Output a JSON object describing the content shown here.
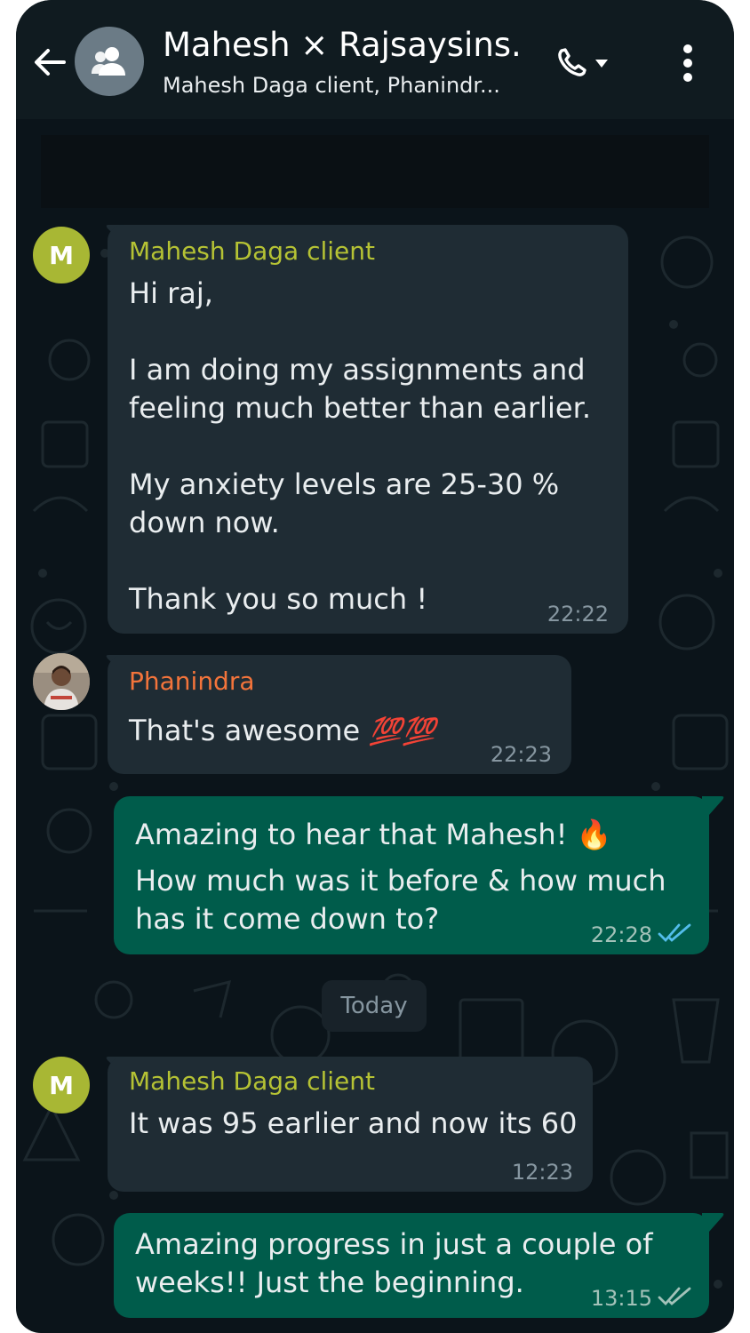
{
  "header": {
    "title": "Mahesh × Rajsaysins...",
    "subtitle": "Mahesh Daga client, Phanindr...",
    "back_icon": "arrow-left-icon",
    "avatar_icon": "group-icon",
    "call_icon": "phone-icon",
    "menu_icon": "more-vertical-icon"
  },
  "colors": {
    "background": "#0b141a",
    "incoming_bubble": "#1f2c34",
    "outgoing_bubble": "#005c4b",
    "mahesh_name": "#b5c234",
    "phanindra_name": "#f3743b",
    "read_ticks": "#53bdeb"
  },
  "messages": [
    {
      "sender": "Mahesh Daga client",
      "avatar_letter": "M",
      "text": "Hi raj,\n\nI am doing my assignments and\nfeeling much better than earlier.\n\nMy anxiety levels are 25-30 %\ndown now.\n\nThank you so much !",
      "time": "22:22"
    },
    {
      "sender": "Phanindra",
      "text": "That's awesome",
      "emoji": "💯💯",
      "time": "22:23"
    },
    {
      "text": "Amazing to hear that Mahesh!",
      "emoji": "🔥",
      "text2": "How much was it before & how much\nhas it come down to?",
      "time": "22:28",
      "status": "read"
    },
    {
      "sender": "Mahesh Daga client",
      "avatar_letter": "M",
      "text": "It was 95 earlier and now its 60",
      "time": "12:23"
    },
    {
      "text": "Amazing progress in just a couple of\nweeks!! Just the beginning.",
      "time": "13:15",
      "status": "delivered"
    }
  ],
  "date_separator": "Today"
}
